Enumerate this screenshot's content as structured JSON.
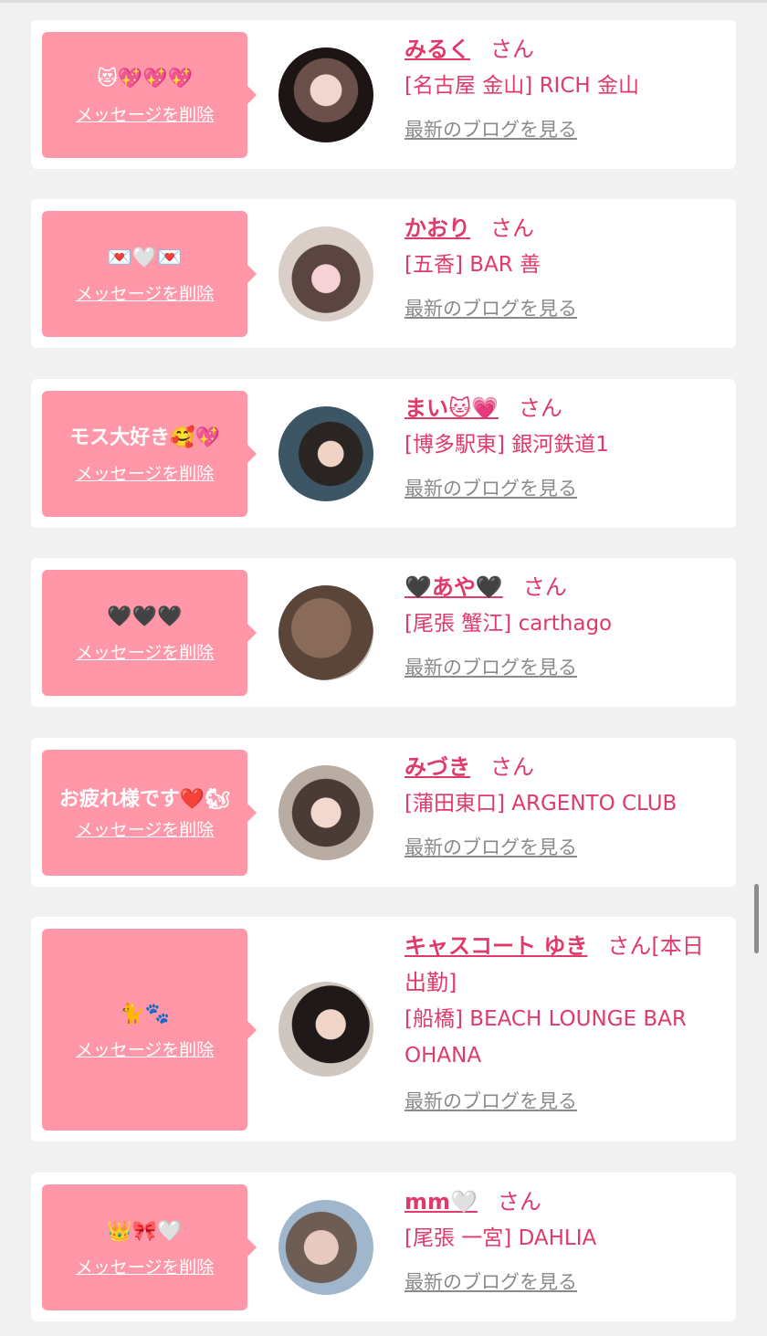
{
  "cards": [
    {
      "message": "😻💖💖💖",
      "delete_label": "メッセージを削除",
      "name": "みるく",
      "honorific": "さん",
      "shop": "[名古屋 金山] RICH 金山",
      "blog_label": "最新のブログを見る"
    },
    {
      "message": "💌🤍💌",
      "delete_label": "メッセージを削除",
      "name": "かおり",
      "honorific": "さん",
      "shop": "[五香] BAR 善",
      "blog_label": "最新のブログを見る"
    },
    {
      "message": "モス大好き🥰💖",
      "delete_label": "メッセージを削除",
      "name": "まい🐱💗",
      "honorific": "さん",
      "shop": "[博多駅東] 銀河鉄道1",
      "blog_label": "最新のブログを見る"
    },
    {
      "message": "🖤🖤🖤",
      "delete_label": "メッセージを削除",
      "name": "🖤あや🖤",
      "honorific": "さん",
      "shop": "[尾張 蟹江] carthago",
      "blog_label": "最新のブログを見る"
    },
    {
      "message": "お疲れ様です❤️🐿",
      "delete_label": "メッセージを削除",
      "name": "みづき",
      "honorific": "さん",
      "shop": "[蒲田東口] ARGENTO CLUB",
      "blog_label": "最新のブログを見る"
    },
    {
      "message": "🐈🐾",
      "delete_label": "メッセージを削除",
      "name": "キャスコート ゆき",
      "honorific": "さん[本日出勤]",
      "shop": "[船橋] BEACH LOUNGE BAR OHANA",
      "blog_label": "最新のブログを見る"
    },
    {
      "message": "👑🎀🤍",
      "delete_label": "メッセージを削除",
      "name": "mm🤍",
      "honorific": "さん",
      "shop": "[尾張 一宮] DAHLIA",
      "blog_label": "最新のブログを見る"
    }
  ]
}
